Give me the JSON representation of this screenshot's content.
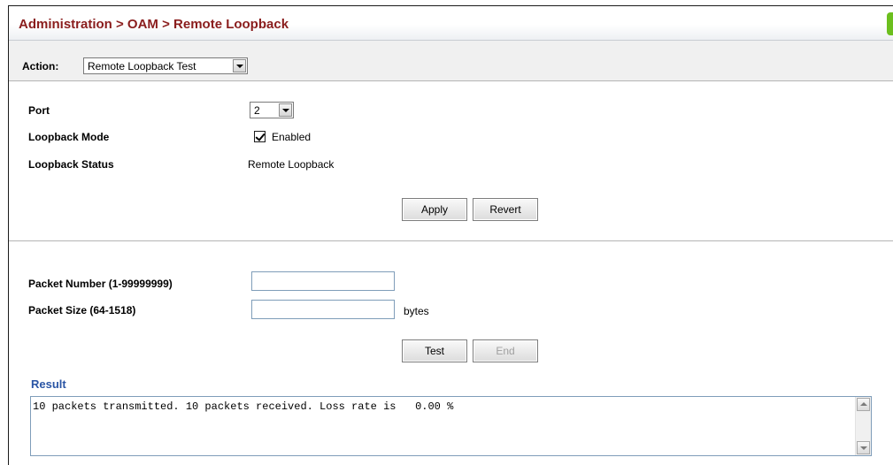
{
  "header": {
    "breadcrumb": "Administration > OAM > Remote Loopback"
  },
  "action": {
    "label": "Action:",
    "selected": "Remote Loopback Test"
  },
  "config": {
    "port_label": "Port",
    "port_value": "2",
    "mode_label": "Loopback Mode",
    "mode_checked": true,
    "mode_option": "Enabled",
    "status_label": "Loopback Status",
    "status_value": "Remote Loopback",
    "apply_label": "Apply",
    "revert_label": "Revert"
  },
  "test": {
    "packet_number_label": "Packet Number (1-99999999)",
    "packet_number_value": "",
    "packet_size_label": "Packet Size (64-1518)",
    "packet_size_value": "",
    "packet_size_unit": "bytes",
    "test_label": "Test",
    "end_label": "End",
    "end_disabled": true
  },
  "result": {
    "label": "Result",
    "text": "10 packets transmitted. 10 packets received. Loss rate is   0.00 %"
  },
  "colors": {
    "title": "#8a1d1d",
    "result_label": "#2a55a5",
    "accent_tab": "#6cbf1e"
  },
  "icons": {
    "dropdown": "chevron-down-icon",
    "checkbox": "checkmark-icon",
    "scroll_up": "scroll-up-arrow-icon",
    "scroll_down": "scroll-down-arrow-icon"
  }
}
